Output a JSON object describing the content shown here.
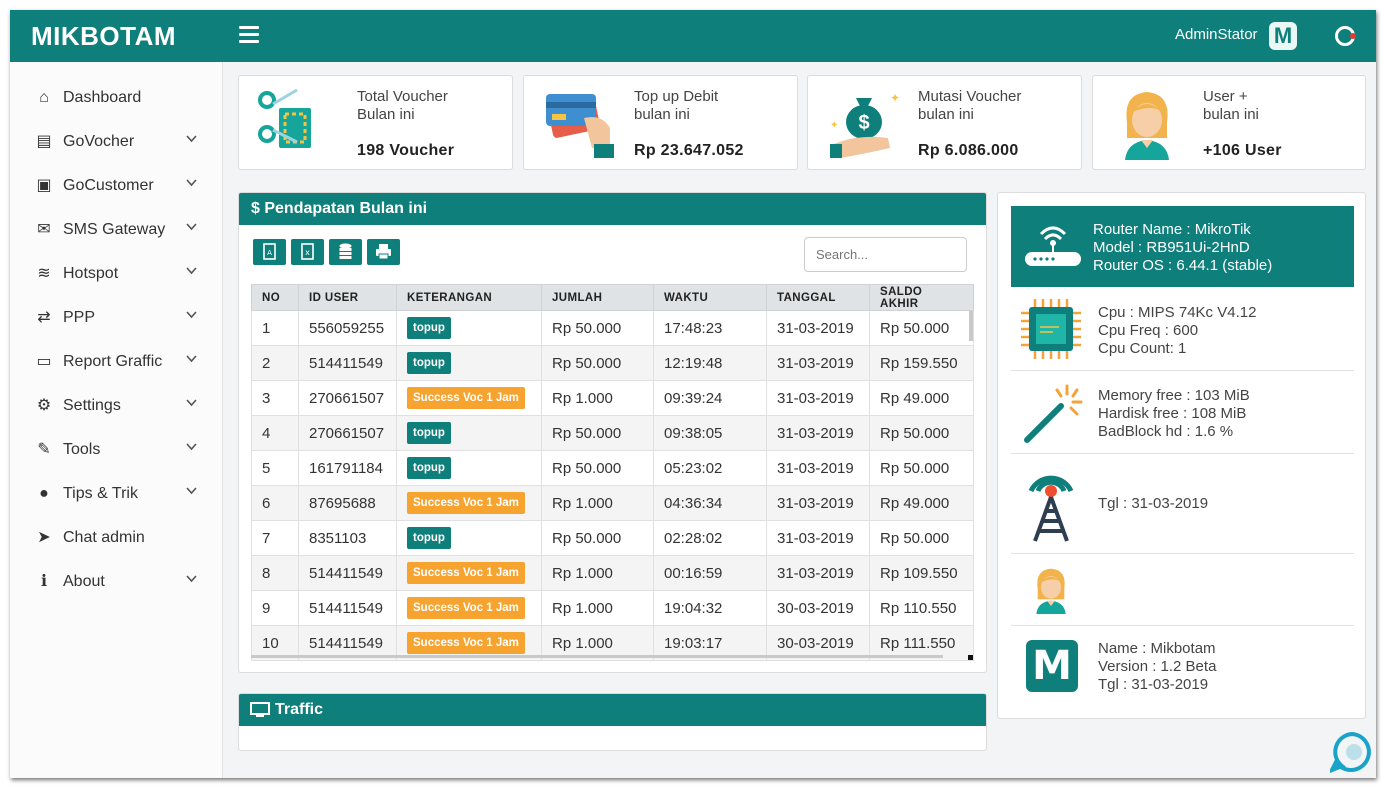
{
  "header": {
    "brand": "MIKBOTAM",
    "user": "AdminStator",
    "logo_letter": "M"
  },
  "sidebar": {
    "items": [
      {
        "label": "Dashboard",
        "icon": "home-icon",
        "glyph": "⌂",
        "chevron": false
      },
      {
        "label": "GoVocher",
        "icon": "files-icon",
        "glyph": "▤",
        "chevron": true
      },
      {
        "label": "GoCustomer",
        "icon": "id-card-icon",
        "glyph": "▣",
        "chevron": true
      },
      {
        "label": "SMS Gateway",
        "icon": "envelope-icon",
        "glyph": "✉",
        "chevron": true
      },
      {
        "label": "Hotspot",
        "icon": "wifi-icon",
        "glyph": "≋",
        "chevron": true
      },
      {
        "label": "PPP",
        "icon": "retweet-icon",
        "glyph": "⇄",
        "chevron": true
      },
      {
        "label": "Report Graffic",
        "icon": "monitor-icon",
        "glyph": "▭",
        "chevron": true
      },
      {
        "label": "Settings",
        "icon": "cogs-icon",
        "glyph": "⚙",
        "chevron": true
      },
      {
        "label": "Tools",
        "icon": "wrench-icon",
        "glyph": "✎",
        "chevron": true
      },
      {
        "label": "Tips & Trik",
        "icon": "chat-icon",
        "glyph": "●",
        "chevron": true
      },
      {
        "label": "Chat admin",
        "icon": "send-icon",
        "glyph": "➤",
        "chevron": false
      },
      {
        "label": "About",
        "icon": "info-icon",
        "glyph": "ℹ",
        "chevron": true
      }
    ]
  },
  "stats": [
    {
      "label1": "Total Voucher",
      "label2": "Bulan ini",
      "value": "198 Voucher"
    },
    {
      "label1": "Top up Debit",
      "label2": "bulan ini",
      "value": "Rp 23.647.052"
    },
    {
      "label1": "Mutasi Voucher",
      "label2": "bulan ini",
      "value": "Rp 6.086.000"
    },
    {
      "label1": "User +",
      "label2": "bulan ini",
      "value": "+106 User"
    }
  ],
  "income": {
    "title": "$ Pendapatan Bulan ini",
    "search_placeholder": "Search...",
    "columns": [
      "NO",
      "ID USER",
      "KETERANGAN",
      "JUMLAH",
      "WAKTU",
      "TANGGAL",
      "SALDO AKHIR"
    ],
    "rows": [
      [
        "1",
        "556059255",
        "topup",
        "Rp 50.000",
        "17:48:23",
        "31-03-2019",
        "Rp 50.000"
      ],
      [
        "2",
        "514411549",
        "topup",
        "Rp 50.000",
        "12:19:48",
        "31-03-2019",
        "Rp 159.550"
      ],
      [
        "3",
        "270661507",
        "Success Voc 1 Jam",
        "Rp 1.000",
        "09:39:24",
        "31-03-2019",
        "Rp 49.000"
      ],
      [
        "4",
        "270661507",
        "topup",
        "Rp 50.000",
        "09:38:05",
        "31-03-2019",
        "Rp 50.000"
      ],
      [
        "5",
        "161791184",
        "topup",
        "Rp 50.000",
        "05:23:02",
        "31-03-2019",
        "Rp 50.000"
      ],
      [
        "6",
        "87695688",
        "Success Voc 1 Jam",
        "Rp 1.000",
        "04:36:34",
        "31-03-2019",
        "Rp 49.000"
      ],
      [
        "7",
        "8351103",
        "topup",
        "Rp 50.000",
        "02:28:02",
        "31-03-2019",
        "Rp 50.000"
      ],
      [
        "8",
        "514411549",
        "Success Voc 1 Jam",
        "Rp 1.000",
        "00:16:59",
        "31-03-2019",
        "Rp 109.550"
      ],
      [
        "9",
        "514411549",
        "Success Voc 1 Jam",
        "Rp 1.000",
        "19:04:32",
        "30-03-2019",
        "Rp 110.550"
      ],
      [
        "10",
        "514411549",
        "Success Voc 1 Jam",
        "Rp 1.000",
        "19:03:17",
        "30-03-2019",
        "Rp 111.550"
      ]
    ]
  },
  "traffic": {
    "title": "Traffic"
  },
  "router": {
    "lines": [
      "Router Name : MikroTik",
      "Model : RB951Ui-2HnD",
      "Router OS : 6.44.1 (stable)"
    ],
    "cpu": [
      "Cpu : MIPS 74Kc V4.12",
      "Cpu Freq : 600",
      "Cpu Count: 1"
    ],
    "memory": [
      "Memory free : 103 MiB",
      "Hardisk free : 108 MiB",
      "BadBlock hd : 1.6 %"
    ],
    "date": "Tgl : 31-03-2019",
    "app": [
      "Name : Mikbotam",
      "Version : 1.2 Beta",
      "Tgl : 31-03-2019"
    ]
  },
  "colors": {
    "primary": "#0e7f7b",
    "warning": "#f7a330"
  }
}
